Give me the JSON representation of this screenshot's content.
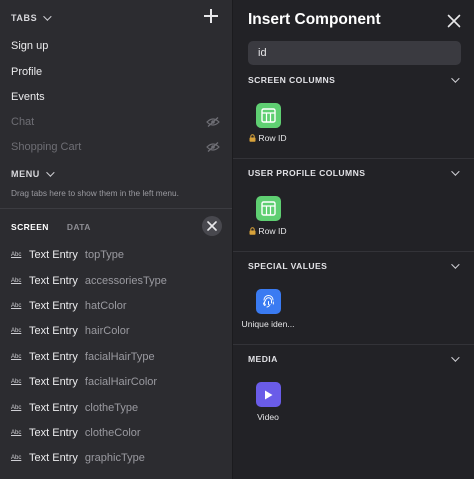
{
  "left_panel": {
    "tabs_header": "TABS",
    "tabs": [
      {
        "label": "Sign up",
        "hidden": false
      },
      {
        "label": "Profile",
        "hidden": false
      },
      {
        "label": "Events",
        "hidden": false
      },
      {
        "label": "Chat",
        "hidden": true
      },
      {
        "label": "Shopping Cart",
        "hidden": true
      }
    ],
    "menu_header": "MENU",
    "menu_hint": "Drag tabs here to show them in the left menu.",
    "view_tabs": {
      "screen": "SCREEN",
      "data": "DATA"
    },
    "entries": [
      {
        "badge": "Abc",
        "type": "Text Entry",
        "name": "topType"
      },
      {
        "badge": "Abc",
        "type": "Text Entry",
        "name": "accessoriesType"
      },
      {
        "badge": "Abc",
        "type": "Text Entry",
        "name": "hatColor"
      },
      {
        "badge": "Abc",
        "type": "Text Entry",
        "name": "hairColor"
      },
      {
        "badge": "Abc",
        "type": "Text Entry",
        "name": "facialHairType"
      },
      {
        "badge": "Abc",
        "type": "Text Entry",
        "name": "facialHairColor"
      },
      {
        "badge": "Abc",
        "type": "Text Entry",
        "name": "clotheType"
      },
      {
        "badge": "Abc",
        "type": "Text Entry",
        "name": "clotheColor"
      },
      {
        "badge": "Abc",
        "type": "Text Entry",
        "name": "graphicType"
      }
    ]
  },
  "right_panel": {
    "title": "Insert Component",
    "search_value": "id",
    "sections": [
      {
        "title": "SCREEN COLUMNS",
        "items": [
          {
            "label": "Row ID",
            "icon": "table-icon",
            "locked": true,
            "color": "#5fcf72"
          }
        ]
      },
      {
        "title": "USER PROFILE COLUMNS",
        "items": [
          {
            "label": "Row ID",
            "icon": "table-icon",
            "locked": true,
            "color": "#5fcf72"
          }
        ]
      },
      {
        "title": "SPECIAL VALUES",
        "items": [
          {
            "label": "Unique iden...",
            "icon": "fingerprint-icon",
            "locked": false,
            "color": "#3a7bf2"
          }
        ]
      },
      {
        "title": "MEDIA",
        "items": [
          {
            "label": "Video",
            "icon": "play-icon",
            "locked": false,
            "color": "#6a5ce8"
          }
        ]
      }
    ]
  }
}
